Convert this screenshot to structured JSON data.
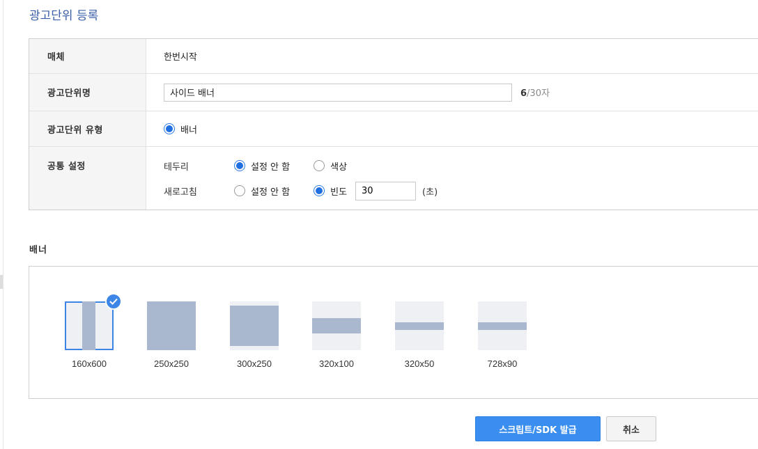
{
  "page": {
    "title": "광고단위 등록"
  },
  "form": {
    "media": {
      "label": "매체",
      "value": "한번시작"
    },
    "unit_name": {
      "label": "광고단위명",
      "value": "사이드 배너",
      "count": "6",
      "limit": "/30자"
    },
    "unit_type": {
      "label": "광고단위 유형",
      "option": "배너",
      "selected": true
    },
    "common": {
      "label": "공통 설정",
      "border": {
        "label": "테두리",
        "options": [
          "설정 안 함",
          "색상"
        ],
        "selected": "설정 안 함"
      },
      "refresh": {
        "label": "새로고침",
        "options": [
          "설정 안 함",
          "빈도"
        ],
        "selected": "빈도",
        "value": "30",
        "unit": "(초)"
      }
    }
  },
  "banner": {
    "section_title": "배너",
    "selected": "160x600",
    "sizes": [
      "160x600",
      "250x250",
      "300x250",
      "320x100",
      "320x50",
      "728x90"
    ]
  },
  "buttons": {
    "submit": "스크립트/SDK 발급",
    "cancel": "취소"
  },
  "colors": {
    "accent": "#3a8ef0",
    "title": "#3a5fa8",
    "thumb_fill": "#aab8cf",
    "thumb_bg": "#eef0f4"
  }
}
